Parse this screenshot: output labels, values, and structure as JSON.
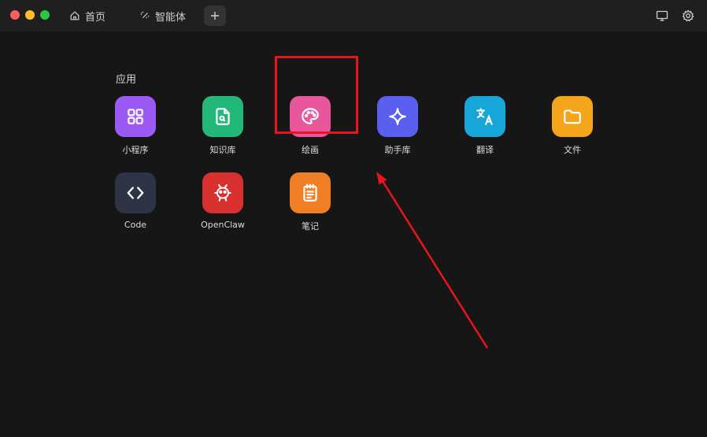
{
  "tabs": {
    "home": "首页",
    "agent": "智能体"
  },
  "section": {
    "title": "应用"
  },
  "apps": [
    {
      "label": "小程序",
      "color": "#9b59f5",
      "icon": "grid-icon"
    },
    {
      "label": "知识库",
      "color": "#22b87a",
      "icon": "document-search-icon"
    },
    {
      "label": "绘画",
      "color": "#e8569b",
      "icon": "palette-icon"
    },
    {
      "label": "助手库",
      "color": "#5a5ff0",
      "icon": "sparkle-icon"
    },
    {
      "label": "翻译",
      "color": "#17a6d8",
      "icon": "translate-icon"
    },
    {
      "label": "文件",
      "color": "#f5a51b",
      "icon": "folder-icon"
    },
    {
      "label": "Code",
      "color": "#2e3446",
      "icon": "code-icon"
    },
    {
      "label": "OpenClaw",
      "color": "#d8302e",
      "icon": "robot-icon"
    },
    {
      "label": "笔记",
      "color": "#f07e25",
      "icon": "notepad-icon"
    }
  ],
  "annotation": {
    "highlight_color": "#e8151b"
  }
}
